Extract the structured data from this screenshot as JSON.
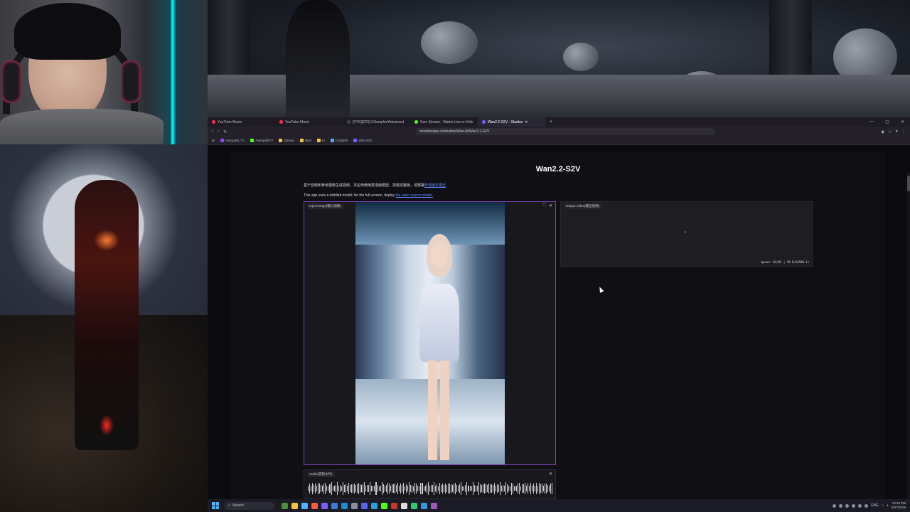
{
  "browser": {
    "tabs": [
      {
        "label": "YouTube Music",
        "color": "#ff2d55"
      },
      {
        "label": "YouTube Music",
        "color": "#ff2d55"
      },
      {
        "label": "[XYS][ZZS] KSampler/Advanced",
        "color": "#444"
      },
      {
        "label": "Sam Stream - Watch Live on Kick",
        "color": "#53fc18"
      },
      {
        "label": "Wan2.2-S2V - Studios",
        "color": "#7b5cff",
        "active": true
      }
    ],
    "url": "modelscope.cn/studios/Wan-AI/Wan2.2-S2V",
    "bookmarks": [
      {
        "label": "Astropath_TV",
        "color": "#9146ff"
      },
      {
        "label": "AstropathTV",
        "color": "#53fc18"
      },
      {
        "label": "Games",
        "color": "#f5c542"
      },
      {
        "label": "Mod",
        "color": "#f5c542"
      },
      {
        "label": "AI",
        "color": "#f5c542"
      },
      {
        "label": "ComfyUI",
        "color": "#4fb3ff"
      },
      {
        "label": "Wan-S2V",
        "color": "#7b5cff"
      }
    ]
  },
  "page": {
    "title": "Wan2.2-S2V",
    "desc_cn_prefix": "基于音频和参考图像生成视频。本应用使用蒸馏版模型。如需完整版，请部署",
    "desc_cn_link": "开源版本模型",
    "desc_en_prefix": "This app uses a distilled model; for the full version, deploy ",
    "desc_en_link": "the open source model."
  },
  "input_panel": {
    "label": "Input Image(输入图像)"
  },
  "audio_panel": {
    "label": "Audio(音频文件)"
  },
  "output_panel": {
    "label": "Output Video(输出视频)",
    "queue": "queue: 82/82 | 59.6/34580.1s"
  },
  "taskbar": {
    "search_placeholder": "Search",
    "time": "10:15 PM",
    "date": "8/27/2025",
    "lang": "ENG"
  },
  "colors": {
    "accent": "#7a3fb0",
    "link": "#5b8cff"
  }
}
